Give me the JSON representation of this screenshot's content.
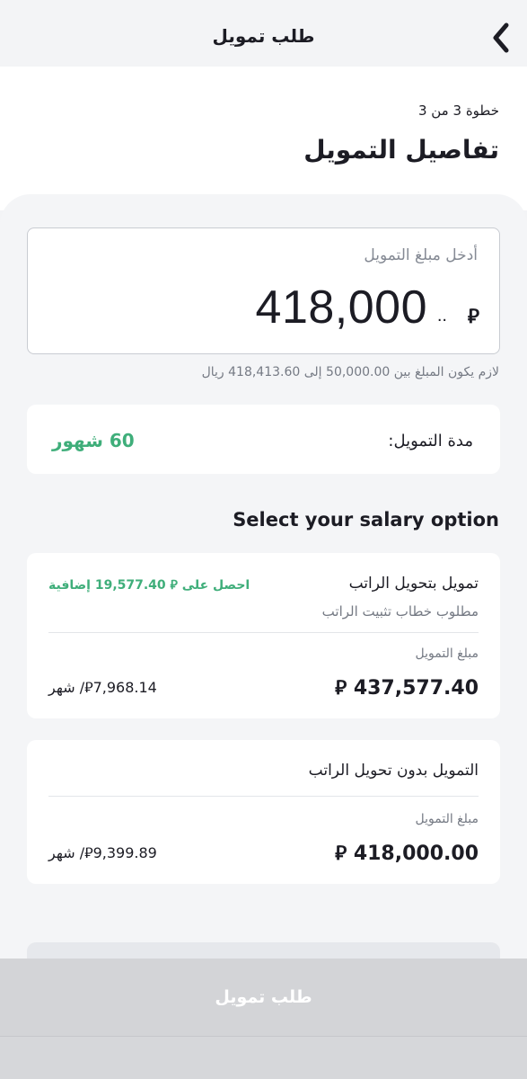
{
  "header": {
    "title": "طلب تمويل",
    "back_icon": "chevron-left-icon"
  },
  "intro": {
    "step": "خطوة 3 من 3",
    "title": "تفاصيل التمويل"
  },
  "amount_field": {
    "label": "أدخل مبلغ التمويل",
    "value": "418,000",
    "dots": "..",
    "currency": "⃁"
  },
  "helper_text": "لازم يكون المبلغ بين 50,000.00 إلى 418,413.60 ريال",
  "duration": {
    "label": "مدة التمويل:",
    "value": "60 شهور"
  },
  "salary_heading": "Select your salary option",
  "options": [
    {
      "title": "تمويل بتحويل الراتب",
      "subtitle": "مطلوب خطاب تثبيت الراتب",
      "promo": "احصل على ⃁ 19,577.40 إضافية",
      "amount_label": "مبلغ التمويل",
      "amount": "⃁ 437,577.40",
      "monthly": "⃁7,968.14/ شهر"
    },
    {
      "title": "التمويل بدون تحويل الراتب",
      "amount_label": "مبلغ التمويل",
      "amount": "⃁ 418,000.00",
      "monthly": "⃁9,399.89/ شهر"
    }
  ],
  "submit": {
    "label": "طلب تمويل"
  },
  "colors": {
    "accent_green": "#3fae7a",
    "text_primary": "#1c1c24",
    "text_secondary": "#757a84",
    "button_disabled": "#d3d4d7"
  }
}
